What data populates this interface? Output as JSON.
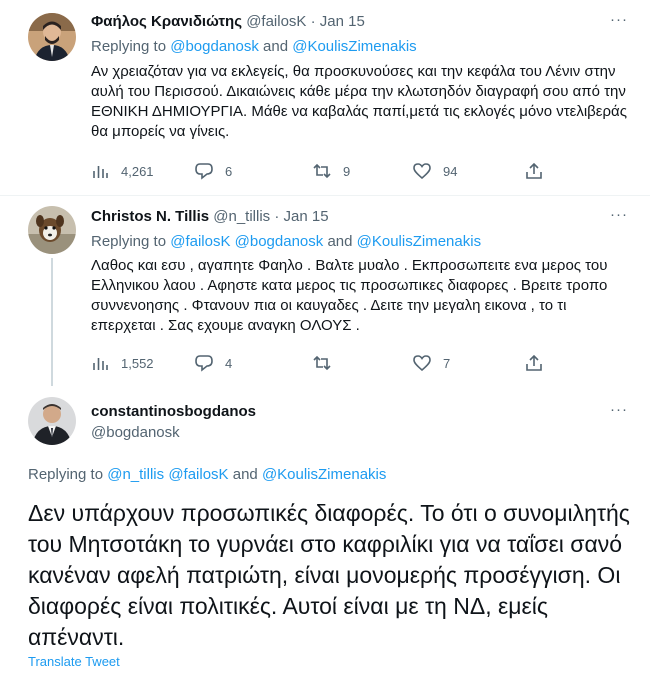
{
  "tweets": [
    {
      "name": "Φαήλος Κρανιδιώτης",
      "handle": "@failosK",
      "dot": "·",
      "date": "Jan 15",
      "replying_prefix": "Replying to",
      "mentions": [
        "@bogdanosk",
        "@KoulisZimenakis"
      ],
      "mention_joiner": "and",
      "text": "Αν χρειαζόταν για να εκλεγείς, θα προσκυνούσες και την κεφάλα του Λένιν στην αυλή του Περισσού. Δικαιώνεις κάθε μέρα την κλωτσηδόν διαγραφή σου από την ΕΘΝΙΚΗ ΔΗΜΙΟΥΡΓΙΑ. Μάθε να καβαλάς παπί,μετά τις εκλογές μόνο ντελιβεράς θα μπορείς να γίνεις.",
      "stats": {
        "views": "4,261",
        "replies": "6",
        "retweets": "9",
        "likes": "94"
      }
    },
    {
      "name": "Christos N. Tillis",
      "handle": "@n_tillis",
      "dot": "·",
      "date": "Jan 15",
      "replying_prefix": "Replying to",
      "mentions": [
        "@failosK",
        "@bogdanosk",
        "@KoulisZimenakis"
      ],
      "mention_joiner": "and",
      "text": "Λαθος και εσυ , αγαπητε Φαηλο . Βαλτε μυαλο . Εκπροσωπειτε ενα μερος του Ελληνικου λαου . Αφηστε κατα μερος τις προσωπικες διαφορες . Βρειτε τροπο συννενοησης . Φτανουν πια οι καυγαδες . Δειτε την μεγαλη εικονα , το τι επερχεται . Σας εχουμε αναγκη ΟΛΟΥΣ .",
      "stats": {
        "views": "1,552",
        "replies": "4",
        "retweets": "",
        "likes": "7"
      }
    }
  ],
  "main_tweet": {
    "name": "constantinosbogdanos",
    "handle": "@bogdanosk",
    "replying_prefix": "Replying to",
    "mentions": [
      "@n_tillis",
      "@failosK",
      "@KoulisZimenakis"
    ],
    "mention_joiner": "and",
    "text": "Δεν υπάρχουν προσωπικές διαφορές. Το ότι ο συνομιλητής του Μητσοτάκη το γυρνάει στο καφριλίκι για να ταΐσει σανό κανέναν αφελή πατριώτη, είναι μονομερής προσέγγιση. Οι διαφορές είναι πολιτικές. Αυτοί είναι με τη ΝΔ, εμείς απέναντι.",
    "translate_label": "Translate Tweet"
  },
  "more_label": "···",
  "colors": {
    "accent": "#1d9bf0",
    "secondary_text": "#536471",
    "divider": "#eff3f4"
  },
  "icons": [
    "analytics-icon",
    "reply-icon",
    "retweet-icon",
    "like-icon",
    "share-icon",
    "more-icon"
  ]
}
